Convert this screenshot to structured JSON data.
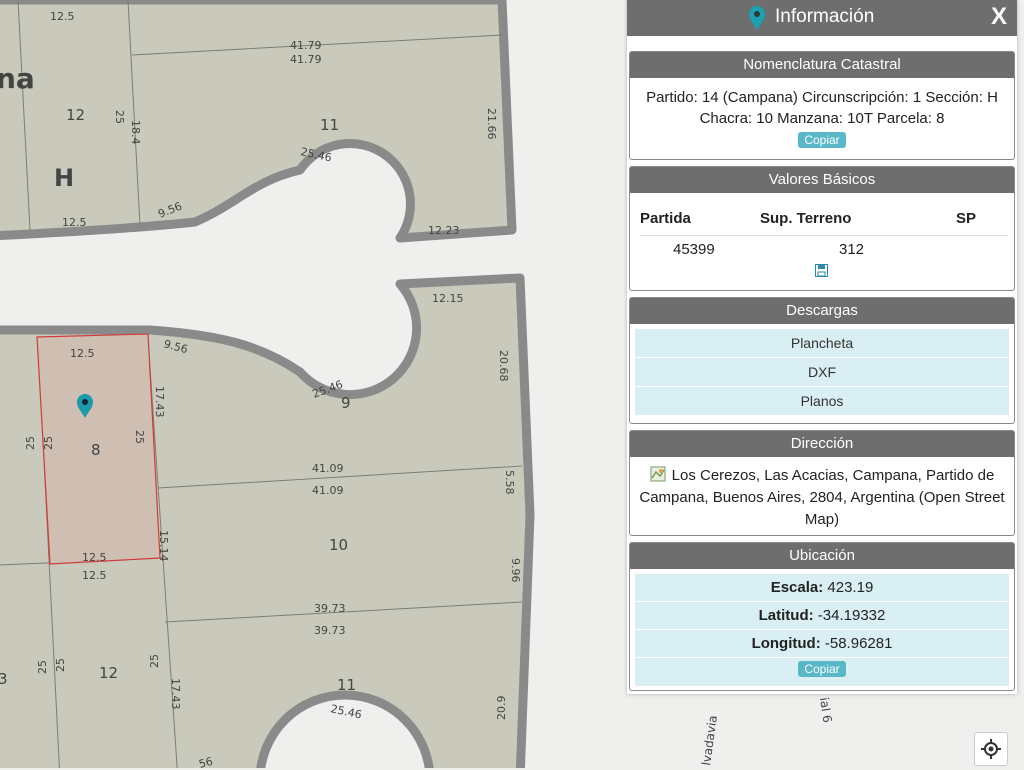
{
  "map": {
    "lot_numbers": {
      "top_left_12": "12",
      "top_11": "11",
      "lot_9": "9",
      "lot_8": "8",
      "lot_10": "10",
      "bottom_12": "12",
      "bottom_11": "11",
      "edge_3": "3"
    },
    "block_letter": "H",
    "partial_name": "na",
    "dimensions": {
      "d_top_12_5": "12.5",
      "d_41_79a": "41.79",
      "d_41_79b": "41.79",
      "d_25_top": "25",
      "d_18_4": "18.4",
      "d_21_66": "21.66",
      "d_25_46_top": "25.46",
      "d_9_56_top": "9.56",
      "d_12_5_upper": "12.5",
      "d_12_23": "12.23",
      "d_12_15": "12.15",
      "d_20_68": "20.68",
      "d_9_56_mid": "9.56",
      "d_12_5_p8top": "12.5",
      "d_17_43_mid": "17.43",
      "d_25_46_mid": "25.46",
      "d_25_a": "25",
      "d_25_b": "25",
      "d_25_c": "25",
      "d_41_09a": "41.09",
      "d_41_09b": "41.09",
      "d_5_58": "5.58",
      "d_12_5_p8bot": "12.5",
      "d_12_5_below": "12.5",
      "d_15_14": "15.14",
      "d_9_96": "9.96",
      "d_39_73a": "39.73",
      "d_39_73b": "39.73",
      "d_25_d": "25",
      "d_25_e": "25",
      "d_25_f": "25",
      "d_17_43_bot": "17.43",
      "d_20_9": "20.9",
      "d_25_46_bot": "25.46",
      "d_56": "56"
    },
    "streets": {
      "vadavia": "lvadavia",
      "ial6": "ial 6"
    }
  },
  "panel": {
    "title": "Información",
    "close_label": "X",
    "nomenclatura": {
      "header": "Nomenclatura Catastral",
      "line1": "Partido: 14 (Campana) Circunscripción: 1 Sección: H",
      "line2": "Chacra: 10 Manzana: 10T Parcela: 8",
      "copy_label": "Copiar"
    },
    "valores": {
      "header": "Valores Básicos",
      "columns": [
        "Partida",
        "Sup. Terreno",
        "SP"
      ],
      "row": [
        "45399",
        "312",
        ""
      ]
    },
    "descargas": {
      "header": "Descargas",
      "items": [
        "Plancheta",
        "DXF",
        "Planos"
      ]
    },
    "direccion": {
      "header": "Dirección",
      "text": "Los Cerezos, Las Acacias, Campana, Partido de Campana, Buenos Aires, 2804, Argentina (Open Street Map)"
    },
    "ubicacion": {
      "header": "Ubicación",
      "escala_label": "Escala:",
      "escala_value": "423.19",
      "latitud_label": "Latitud:",
      "latitud_value": "-34.19332",
      "longitud_label": "Longitud:",
      "longitud_value": "-58.96281",
      "copy_label": "Copiar"
    }
  },
  "colors": {
    "parcel_fill": "#c9cabb",
    "block_outline": "#8a8a8a",
    "selected_parcel": "#cfbfb3",
    "selected_border": "#d23a3a",
    "marker": "#1a9aaa",
    "header_bg": "#6e6e6e",
    "accent_button": "#58b8c8",
    "row_bg": "#d9eff3"
  }
}
